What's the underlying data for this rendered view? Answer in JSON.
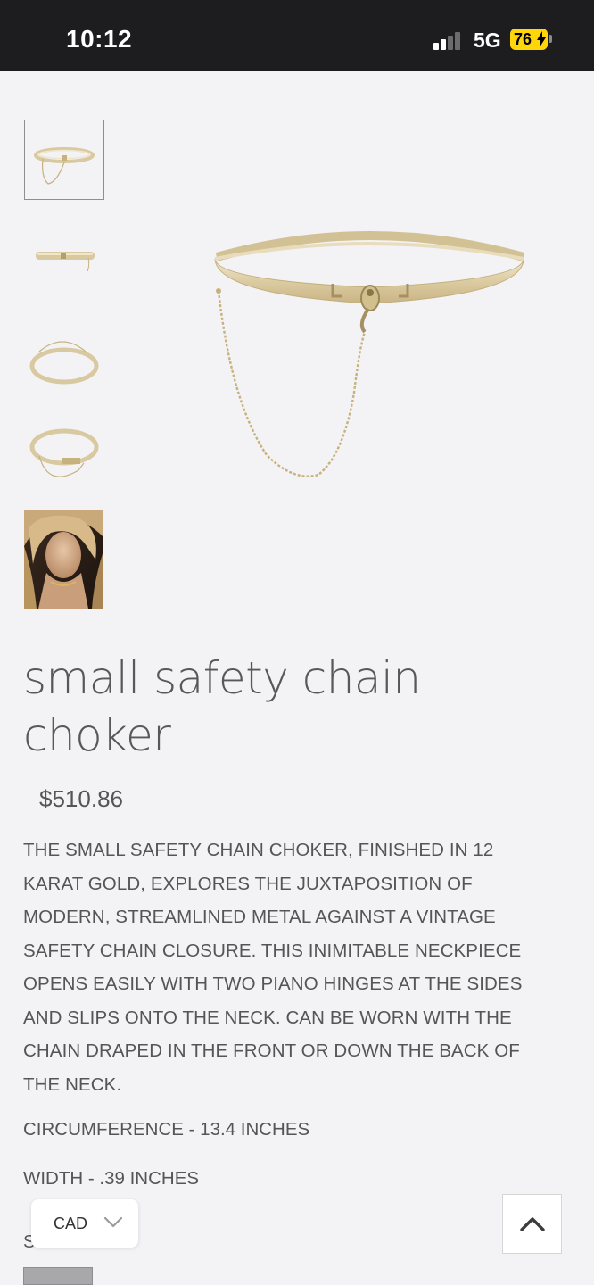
{
  "status_bar": {
    "time": "10:12",
    "network": "5G",
    "battery": "76"
  },
  "product": {
    "title": "small safety chain choker",
    "price": "$510.86",
    "description": "THE SMALL SAFETY CHAIN CHOKER, FINISHED IN 12 KARAT GOLD, EXPLORES THE JUXTAPOSITION OF MODERN, STREAMLINED METAL AGAINST A VINTAGE SAFETY CHAIN CLOSURE. THIS INIMITABLE NECKPIECE OPENS EASILY WITH TWO PIANO HINGES AT THE SIDES AND SLIPS ONTO THE NECK. CAN BE WORN WITH THE CHAIN DRAPED IN THE FRONT OR DOWN THE BACK OF THE NECK.",
    "circumference": "CIRCUMFERENCE - 13.4 INCHES",
    "width": "WIDTH - .39 INCHES",
    "size_label_partial": "S"
  },
  "gallery": {
    "thumbnails": [
      "choker-front-with-chain",
      "choker-side",
      "choker-open",
      "choker-with-chain-angle",
      "model-wearing-choker"
    ],
    "selected_index": 0
  },
  "currency": {
    "selected": "CAD"
  },
  "colors": {
    "status_bar_bg": "#1d1d1f",
    "battery": "#ffd60a",
    "page_bg": "#f3f2f4",
    "gold": "#d8c9a0"
  },
  "icons": {
    "currency_dropdown": "chevron-down-icon",
    "scroll_top": "chevron-up-icon"
  }
}
